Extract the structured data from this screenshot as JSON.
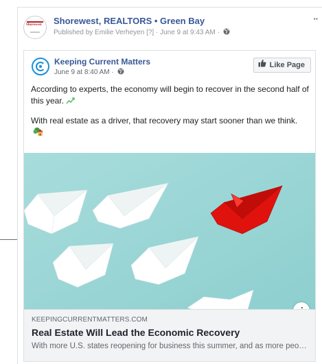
{
  "post": {
    "page_name": "Shorewest, REALTORS • Green Bay",
    "meta_text": "Published by Emilie Verheyen [?] · June 9 at 9:43 AM ·",
    "avatar_logo_text": "Shorewest",
    "privacy_icon": "globe-icon",
    "more_icon": "more-dots-icon",
    "more_glyph": "··"
  },
  "shared_post": {
    "page_name": "Keeping Current Matters",
    "timestamp": "June 9 at 8:40 AM ·",
    "like_page_label": "Like Page",
    "paragraphs": [
      "According to experts, the economy will begin to recover in the second half of this year.",
      "With real estate as a driver, that recovery may start sooner than we think."
    ],
    "paragraph_icons": [
      "chart-increasing-icon",
      "house-with-garden-icon"
    ]
  },
  "link_preview": {
    "info_label": "i",
    "domain": "KEEPINGCURRENTMATTERS.COM",
    "title": "Real Estate Will Lead the Economic Recovery",
    "description": "With more U.S. states reopening for business this summer, and as more people get back to work, the economy will start to recover."
  },
  "colors": {
    "link_blue": "#385898",
    "meta_gray": "#90949c",
    "footer_bg": "#f2f3f5",
    "image_bg": "#9fd6d5",
    "red_boat": "#e0120e",
    "brand_blue": "#1a8fd6"
  }
}
